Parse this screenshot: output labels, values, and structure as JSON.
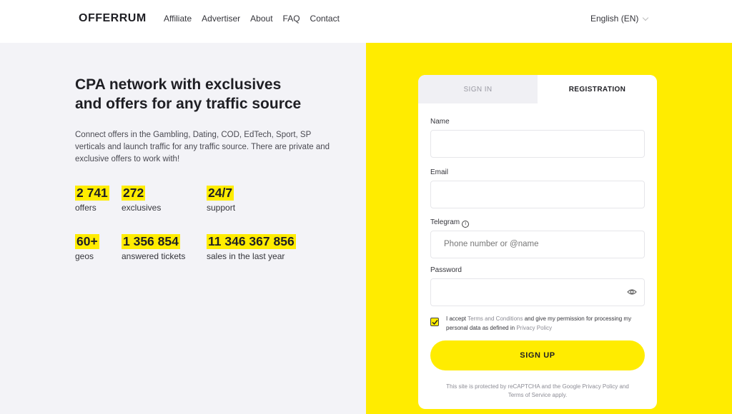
{
  "header": {
    "logo": "OFFERRUM",
    "nav": [
      "Affiliate",
      "Advertiser",
      "About",
      "FAQ",
      "Contact"
    ],
    "language": "English (EN)"
  },
  "hero": {
    "headline_line1": "CPA network with exclusives",
    "headline_line2": "and offers for any traffic source",
    "intro": "Connect offers in the Gambling, Dating, COD, EdTech, Sport, SP verticals and launch traffic for any traffic source. There are private and exclusive offers to work with!"
  },
  "stats": [
    {
      "value": "2 741",
      "label": "offers"
    },
    {
      "value": "272",
      "label": "exclusives"
    },
    {
      "value": "24/7",
      "label": "support"
    },
    {
      "value": "60+",
      "label": "geos"
    },
    {
      "value": "1 356 854",
      "label": "answered tickets"
    },
    {
      "value": "11 346 367 856",
      "label": "sales in the last year"
    }
  ],
  "form": {
    "tab_signin": "SIGN IN",
    "tab_registration": "REGISTRATION",
    "name_label": "Name",
    "email_label": "Email",
    "telegram_label": "Telegram",
    "telegram_placeholder": "Phone number or @name",
    "password_label": "Password",
    "consent_prefix": "I accept",
    "consent_terms": "Terms and Conditions",
    "consent_middle": "and give my permission for processing my personal data as defined in",
    "consent_privacy": "Privacy Policy",
    "submit_label": "SIGN UP",
    "recaptcha_note": "This site is protected by reCAPTCHA and the Google Privacy Policy and Terms of Service apply."
  },
  "colors": {
    "accent": "#ffec00",
    "left_bg": "#f3f3f7"
  }
}
